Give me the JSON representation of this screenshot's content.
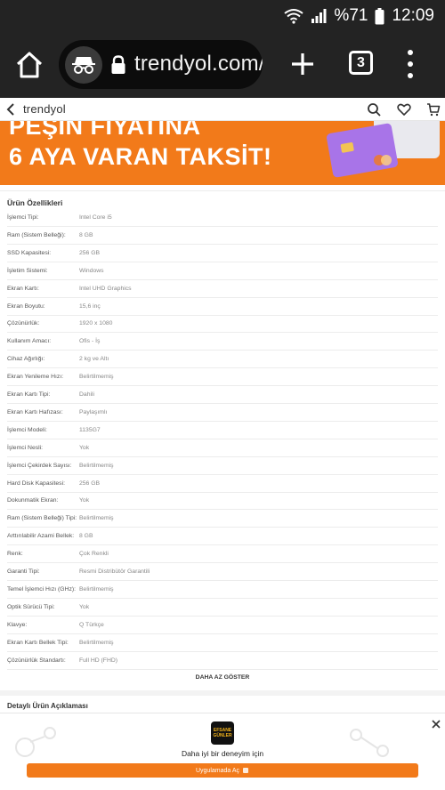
{
  "status_bar": {
    "battery_percent": "%71",
    "time": "12:09"
  },
  "browser": {
    "url": "trendyol.com/",
    "tab_count": "3"
  },
  "site_header": {
    "brand": "trendyol"
  },
  "promo": {
    "line1": "PEŞİN FİYATINA",
    "line2": "6 AYA VARAN TAKSİT!"
  },
  "specs": {
    "title": "Ürün Özellikleri",
    "rows": [
      {
        "key": "İşlemci Tipi:",
        "value": "Intel Core i5"
      },
      {
        "key": "Ram (Sistem Belleği):",
        "value": "8 GB"
      },
      {
        "key": "SSD Kapasitesi:",
        "value": "256 GB"
      },
      {
        "key": "İşletim Sistemi:",
        "value": "Windows"
      },
      {
        "key": "Ekran Kartı:",
        "value": "Intel UHD Graphics"
      },
      {
        "key": "Ekran Boyutu:",
        "value": "15,6 inç"
      },
      {
        "key": "Çözünürlük:",
        "value": "1920 x 1080"
      },
      {
        "key": "Kullanım Amacı:",
        "value": "Ofis - İş"
      },
      {
        "key": "Cihaz Ağırlığı:",
        "value": "2 kg ve Altı"
      },
      {
        "key": "Ekran Yenileme Hızı:",
        "value": "Belirtilmemiş"
      },
      {
        "key": "Ekran Kartı Tipi:",
        "value": "Dahili"
      },
      {
        "key": "Ekran Kartı Hafızası:",
        "value": "Paylaşımlı"
      },
      {
        "key": "İşlemci Modeli:",
        "value": "1135G7"
      },
      {
        "key": "İşlemci Nesli:",
        "value": "Yok"
      },
      {
        "key": "İşlemci Çekirdek Sayısı:",
        "value": "Belirtilmemiş"
      },
      {
        "key": "Hard Disk Kapasitesi:",
        "value": "256 GB"
      },
      {
        "key": "Dokunmatik Ekran:",
        "value": "Yok"
      },
      {
        "key": "Ram (Sistem Belleği) Tipi:",
        "value": "Belirtilmemiş"
      },
      {
        "key": "Arttırılabilir Azami Bellek:",
        "value": "8 GB"
      },
      {
        "key": "Renk:",
        "value": "Çok Renkli"
      },
      {
        "key": "Garanti Tipi:",
        "value": "Resmi Distribütör Garantili"
      },
      {
        "key": "Temel İşlemci Hızı (GHz):",
        "value": "Belirtilmemiş"
      },
      {
        "key": "Optik Sürücü Tipi:",
        "value": "Yok"
      },
      {
        "key": "Klavye:",
        "value": "Q Türkçe"
      },
      {
        "key": "Ekran Kartı Bellek Tipi:",
        "value": "Belirtilmemiş"
      },
      {
        "key": "Çözünürlük Standartı:",
        "value": "Full HD (FHD)"
      }
    ],
    "show_less_label": "DAHA AZ GÖSTER"
  },
  "description": {
    "title": "Detaylı Ürün Açıklaması"
  },
  "app_banner": {
    "logo_text": [
      "EFSANE",
      "GÜNLER"
    ],
    "text": "Daha iyi bir deneyim için",
    "button_label": "Uygulamada Aç"
  },
  "colors": {
    "accent": "#f27a1a",
    "browser_chrome": "#232323",
    "url_pill": "#0c0c0c"
  },
  "icons": [
    "wifi-icon",
    "signal-icon",
    "battery-icon",
    "home-icon",
    "incognito-icon",
    "lock-icon",
    "plus-icon",
    "tab-switcher-icon",
    "more-vert-icon",
    "chevron-left-icon",
    "search-icon",
    "heart-icon",
    "cart-icon",
    "close-icon"
  ]
}
